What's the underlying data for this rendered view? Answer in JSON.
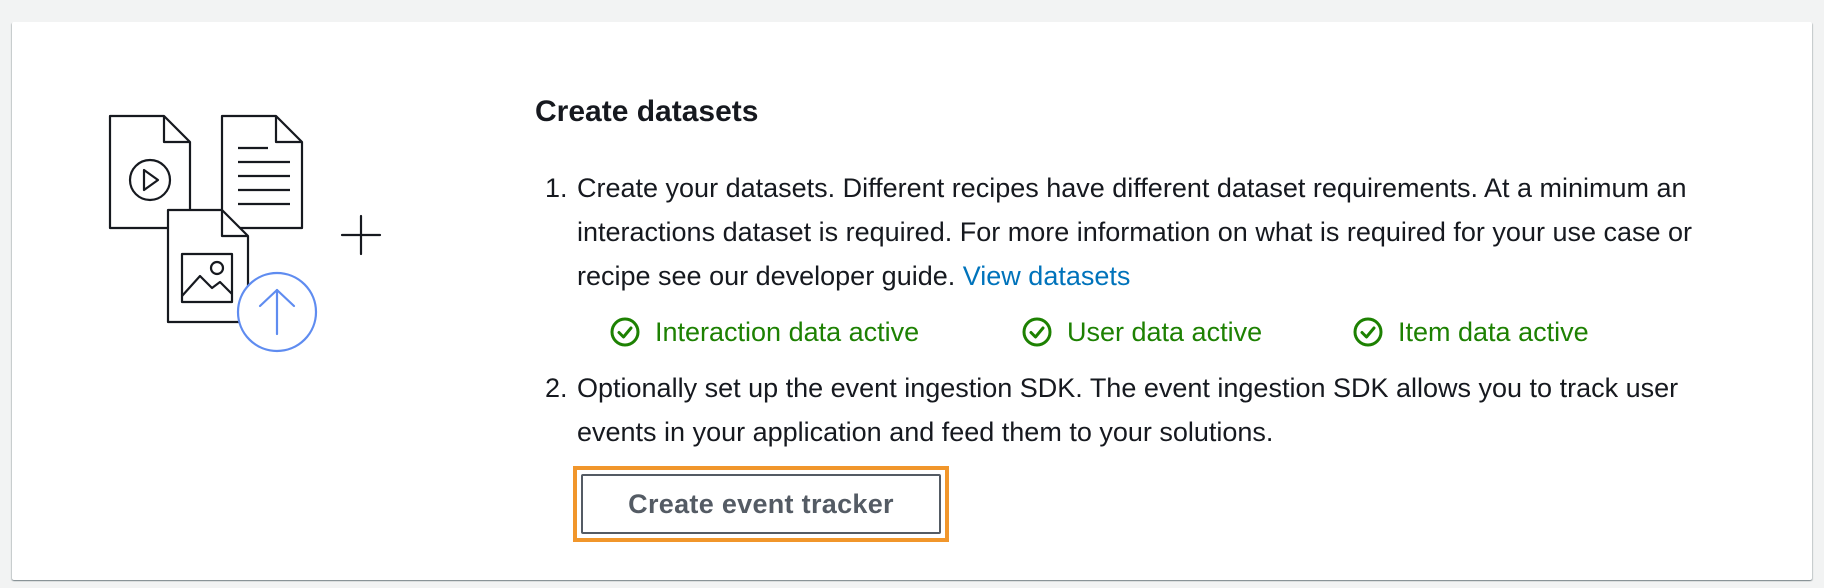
{
  "section": {
    "title": "Create datasets",
    "steps": [
      {
        "text": "Create your datasets. Different recipes have different dataset requirements. At a minimum an interactions dataset is required. For more information on what is required for your use case or recipe see our developer guide. ",
        "link_label": "View datasets"
      },
      {
        "text": "Optionally set up the event ingestion SDK. The event ingestion SDK allows you to track user events in your application and feed them to your solutions."
      }
    ],
    "statuses": [
      {
        "label": "Interaction data active",
        "icon": "check-circle-icon"
      },
      {
        "label": "User data active",
        "icon": "check-circle-icon"
      },
      {
        "label": "Item data active",
        "icon": "check-circle-icon"
      }
    ],
    "button_label": "Create event tracker"
  },
  "colors": {
    "success": "#1d8102",
    "link": "#0073bb",
    "highlight": "#f1962b",
    "upload_icon": "#5f8cf0"
  }
}
